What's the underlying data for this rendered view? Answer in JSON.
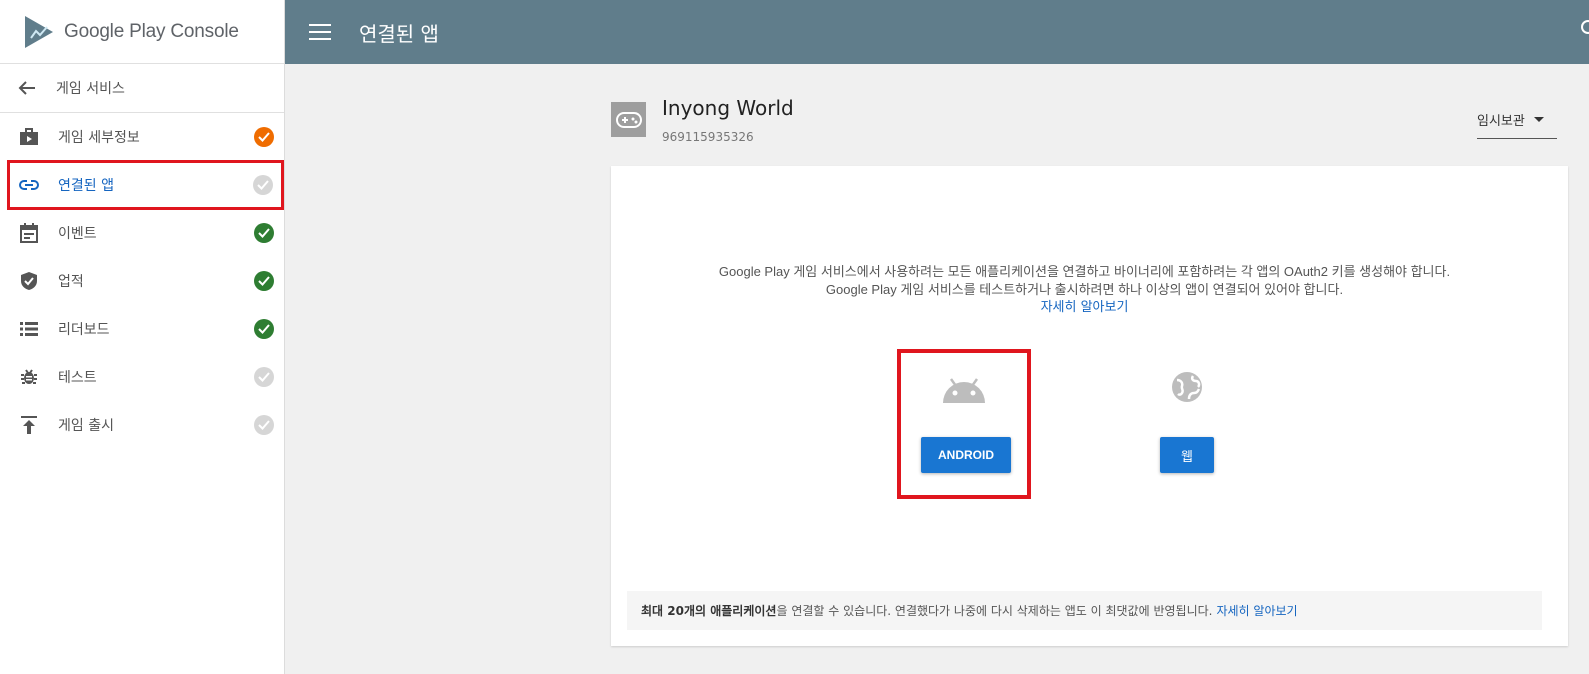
{
  "brand": {
    "name_google": "Google Play",
    "name_console": "Console"
  },
  "sidebar": {
    "back_label": "게임 서비스",
    "items": [
      {
        "label": "게임 세부정보",
        "icon": "briefcase-icon",
        "status": "orange"
      },
      {
        "label": "연결된 앱",
        "icon": "link-icon",
        "status": "gray",
        "active": true
      },
      {
        "label": "이벤트",
        "icon": "calendar-icon",
        "status": "green"
      },
      {
        "label": "업적",
        "icon": "shield-icon",
        "status": "green"
      },
      {
        "label": "리더보드",
        "icon": "list-icon",
        "status": "green"
      },
      {
        "label": "테스트",
        "icon": "bug-icon",
        "status": "gray"
      },
      {
        "label": "게임 출시",
        "icon": "publish-icon",
        "status": "gray"
      }
    ]
  },
  "topbar": {
    "title": "연결된 앱"
  },
  "app": {
    "name": "Inyong World",
    "id": "969115935326",
    "save_state": "임시보관"
  },
  "card": {
    "description": "Google Play 게임 서비스에서 사용하려는 모든 애플리케이션을 연결하고 바이너리에 포함하려는 각 앱의 OAuth2 키를 생성해야 합니다. Google Play 게임 서비스를 테스트하거나 출시하려면 하나 이상의 앱이 연결되어 있어야 합니다.",
    "learn_more": "자세히 알아보기",
    "android_label": "ANDROID",
    "web_label": "웹",
    "footer_bold": "최대 20개의 애플리케이션",
    "footer_text": "을 연결할 수 있습니다. 연결했다가 나중에 다시 삭제하는 앱도 이 최댓값에 반영됩니다.",
    "footer_link": "자세히 알아보기"
  },
  "colors": {
    "topbar": "#607d8b",
    "accent_blue": "#1976d2",
    "highlight_red": "#e0161e",
    "status_orange": "#ef6c00",
    "status_green": "#2e7d32",
    "status_gray": "#d6d6d6"
  }
}
